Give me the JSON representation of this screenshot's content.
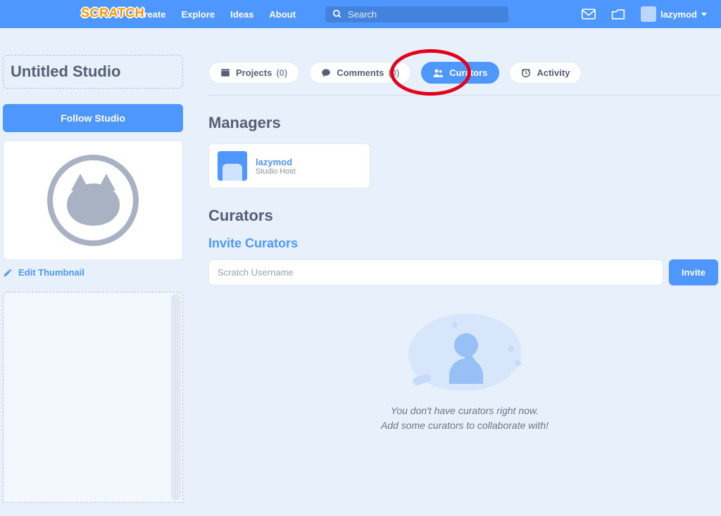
{
  "nav": {
    "logo_text": "SCRATCH",
    "links": {
      "create": "Create",
      "explore": "Explore",
      "ideas": "Ideas",
      "about": "About"
    },
    "search_placeholder": "Search",
    "username": "lazymod"
  },
  "sidebar": {
    "title": "Untitled Studio",
    "follow_label": "Follow Studio",
    "edit_thumb_label": "Edit Thumbnail"
  },
  "tabs": {
    "projects": {
      "label": "Projects",
      "count": "(0)"
    },
    "comments": {
      "label": "Comments",
      "count": "(0)"
    },
    "curators": {
      "label": "Curators"
    },
    "activity": {
      "label": "Activity"
    }
  },
  "sections": {
    "managers_heading": "Managers",
    "curators_heading": "Curators",
    "invite_heading": "Invite Curators"
  },
  "managers": {
    "0": {
      "name": "lazymod",
      "role": "Studio Host"
    }
  },
  "invite": {
    "placeholder": "Scratch Username",
    "button": "Invite"
  },
  "empty": {
    "line1": "You don't have curators right now.",
    "line2": "Add some curators to collaborate with!"
  }
}
